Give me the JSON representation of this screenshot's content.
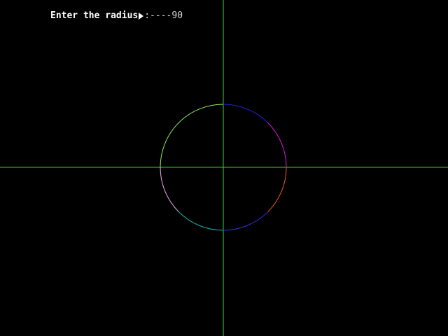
{
  "prompt": {
    "label": "Enter the radius",
    "separator": ":----",
    "value": "90"
  },
  "colors": {
    "background": "#000000",
    "axes": "#3ccf3c",
    "prompt_text": "#ffffff",
    "arc_upper_left": "#90ee60",
    "arc_upper_right": "#2020d0",
    "arc_right_upper": "#d020d0",
    "arc_right_lower": "#e06010",
    "arc_lower_right": "#3030e0",
    "arc_lower_left": "#20b0b0",
    "arc_left_lower": "#e8b0e8"
  },
  "circle": {
    "radius": 90
  },
  "cursor_icon": "arrow-right-icon"
}
